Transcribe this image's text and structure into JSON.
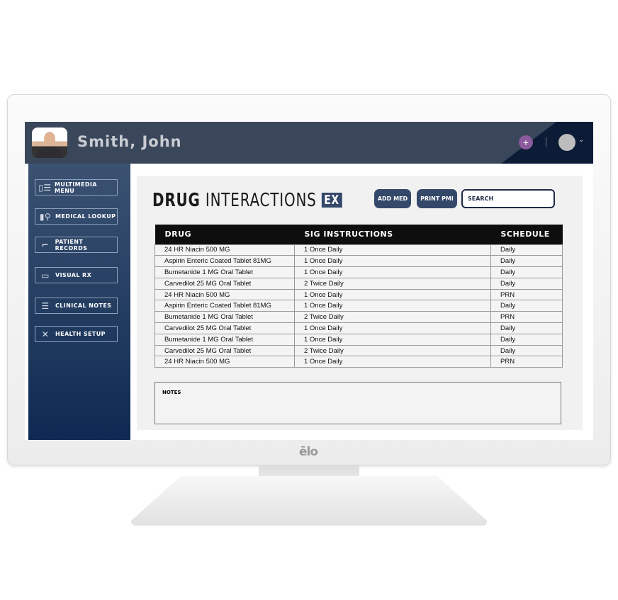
{
  "brand": "ēlo",
  "header": {
    "patient_name": "Smith, John",
    "add_icon": "plus-icon",
    "user_icon": "user-avatar",
    "menu_icon": "chevron-down-icon"
  },
  "sidebar": {
    "items": [
      {
        "label": "MULTIMEDIA MENU",
        "icon": "layout-icon"
      },
      {
        "label": "MEDICAL LOOKUP",
        "icon": "chart-search-icon"
      },
      {
        "label": "PATIENT RECORDS",
        "icon": "bed-icon"
      },
      {
        "label": "VISUAL RX",
        "icon": "window-icon"
      },
      {
        "label": "CLINICAL NOTES",
        "icon": "list-icon"
      },
      {
        "label": "HEALTH SETUP",
        "icon": "tools-icon"
      }
    ]
  },
  "main": {
    "title_bold": "DRUG",
    "title_rest": "INTERACTIONS",
    "title_badge": "EX",
    "add_med": "ADD MED",
    "print_pmi": "PRINT PMI",
    "search_placeholder": "SEARCH",
    "columns": [
      "DRUG",
      "SIG INSTRUCTIONS",
      "SCHEDULE"
    ],
    "rows": [
      [
        "24 HR Niacin 500 MG",
        "1 Once Daily",
        "Daily"
      ],
      [
        "Aspirin Enteric Coated Tablet 81MG",
        "1 Once Daily",
        "Daily"
      ],
      [
        "Bumetanide 1 MG Oral Tablet",
        "1 Once Daily",
        "Daily"
      ],
      [
        "Carvedilot 25 MG Oral Tablet",
        "2 Twice Daily",
        "Daily"
      ],
      [
        "24 HR Niacin 500 MG",
        "1 Once Daily",
        "PRN"
      ],
      [
        "Aspirin Enteric Coated Tablet 81MG",
        "1 Once Daily",
        "Daily"
      ],
      [
        "Bumetanide 1 MG Oral Tablet",
        "2 Twice Daily",
        "PRN"
      ],
      [
        "Carvedilot 25 MG Oral Tablet",
        "1 Once Daily",
        "Daily"
      ],
      [
        "Bumetanide 1 MG Oral Tablet",
        "1 Once Daily",
        "Daily"
      ],
      [
        "Carvedilot 25 MG Oral Tablet",
        "2 Twice Daily",
        "Daily"
      ],
      [
        "24 HR Niacin 500 MG",
        "1 Once Daily",
        "PRN"
      ]
    ],
    "notes_label": "NOTES"
  },
  "colors": {
    "header": "#3a475a",
    "accent": "#34486a",
    "plus": "#8a5a9c"
  }
}
